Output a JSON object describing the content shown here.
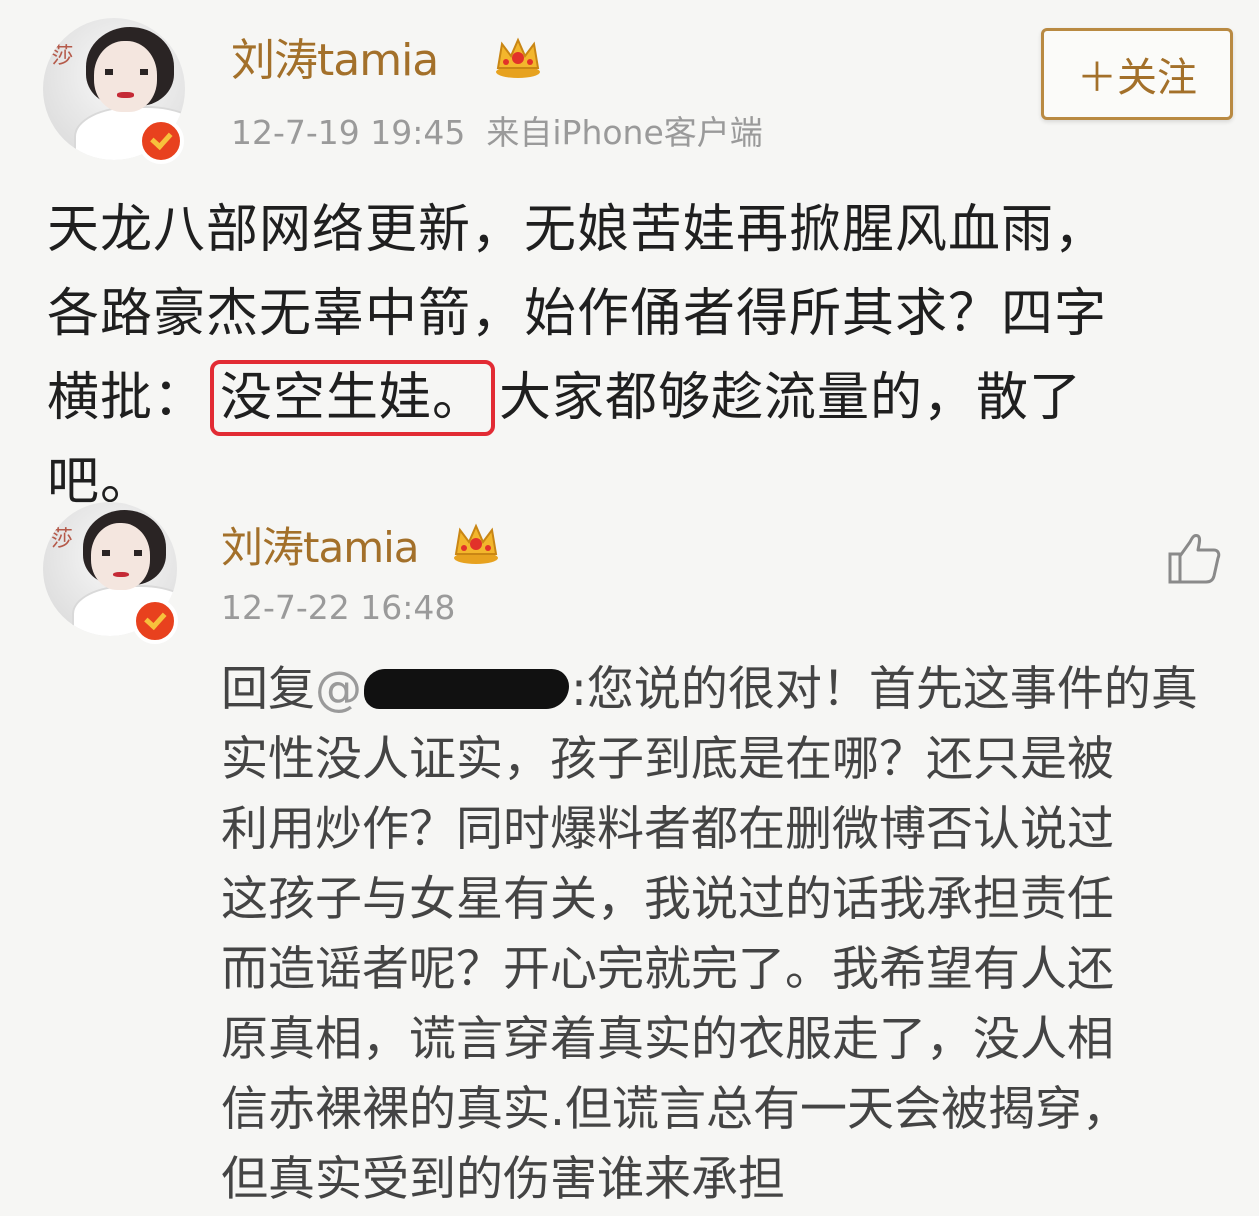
{
  "post": {
    "username": "刘涛tamia",
    "timestamp": "12-7-19 19:45",
    "source": "来自iPhone客户端",
    "follow_label": "＋关注",
    "body_lines": [
      "天龙八部网络更新，无娘苦娃再掀腥风血雨，",
      "各路豪杰无辜中箭，始作俑者得所其求？四字"
    ],
    "line3_prefix": "横批：",
    "highlighted_text": "没空生娃。",
    "line3_suffix": "大家都够趁流量的，散了",
    "line4": "吧。"
  },
  "reply": {
    "username": "刘涛tamia",
    "timestamp": "12-7-22 16:48",
    "prefix": "回复",
    "at_symbol": "@",
    "first_line_rest": ":您说的很对！首先这事件的真",
    "lines": [
      "实性没人证实，孩子到底是在哪？还只是被",
      "利用炒作？同时爆料者都在删微博否认说过",
      "这孩子与女星有关，我说过的话我承担责任",
      "而造谣者呢？开心完就完了。我希望有人还",
      "原真相，谎言穿着真实的衣服走了，没人相",
      "信赤裸裸的真实.但谎言总有一天会被揭穿，",
      "但真实受到的伤害谁来承担"
    ]
  },
  "colors": {
    "username": "#a3702a",
    "highlight_border": "#e22b34",
    "verified_badge": "#e8411e"
  },
  "icons": [
    "verified-badge-icon",
    "crown-icon",
    "like-thumb-icon"
  ]
}
